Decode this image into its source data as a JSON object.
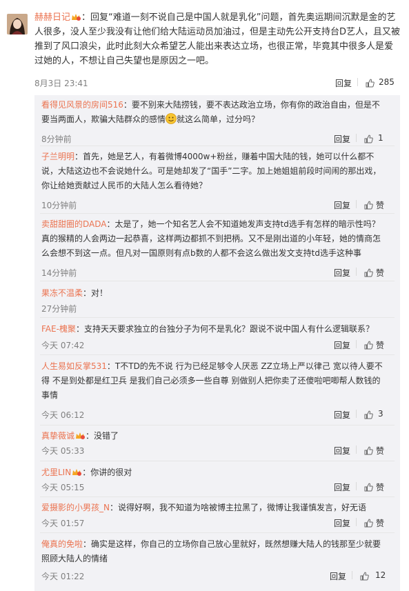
{
  "main_comment": {
    "username": "赫赫日记",
    "text": "：回复“难道一刻不说自己是中国人就是乳化”问题，首先奥运期间沉默是金的艺人很多，没人至少我没有让他们给大陆运动员加油过，但是主动先公开支持台D艺人，且又被推到了风口浪尖，此时此刻大众希望艺人能出来表达立场，也很正常，毕竟其中很多人是爱过她的人，不想让自己失望也是原因之一吧。",
    "time": "8月3日 23:41",
    "reply_label": "回复",
    "likes": "285"
  },
  "replies": [
    {
      "username": "看得见风景的房间516",
      "text_parts": [
        "：要不别来大陆捞钱，要不表达政治立场，你有你的政治自由，但是不要当两面人，欺骗大陆群众的感情",
        "就这么简单，过分吗？"
      ],
      "time": "8分钟前",
      "reply_label": "回复",
      "likes": "1"
    },
    {
      "username": "子兰明明",
      "text": "：首先，她是艺人，有着微博4000w+粉丝，赚着中国大陆的钱，她可以什么都不说，大陆这边也不会说她什么。可是她却发了“国手”二字。加上她姐姐前段时间闹的那出戏，你让给她贡献过人民币的大陆人怎么看待她？",
      "time": "10分钟前",
      "reply_label": "回复",
      "likes": "赞"
    },
    {
      "username": "卖甜甜圈的DADA",
      "text": "：太是了，她一个知名艺人会不知道她发声支持td选手有怎样的暗示性吗？真的猴精的人会两边一起恭喜，这样两边都抓不到把柄。又不是刚出道的小年轻，她的情商怎么会想不到这一点。但凡对一国原则有点b数的人都不会这么做出发文支持td选手这种事",
      "time": "14分钟前",
      "reply_label": "回复",
      "likes": "赞"
    },
    {
      "username": "果冻不温柔",
      "text": "：对！",
      "time": "27分钟前",
      "reply_label": "回复",
      "likes": "赞"
    },
    {
      "username": "FAE-槐聚",
      "text": "：支持天天要求独立的台独分子为何不是乳化？跟说不说中国人有什么逻辑联系？",
      "time": "今天 07:42",
      "reply_label": "回复",
      "likes": "赞"
    },
    {
      "username": "人生易如反掌531",
      "text": "：T不TD的先不说 行为已经足够令人厌恶 ZZ立场上严以律己 宽以待人要不得 不是到处都是红卫兵 是我们自己必须多一些自尊 别做别人把你卖了还傻啦吧唧帮人数钱的事情",
      "time": "今天 06:12",
      "reply_label": "回复",
      "likes": "3"
    },
    {
      "username": "真挚薇诚",
      "text": "：没错了",
      "time": "今天 05:33",
      "reply_label": "回复",
      "likes": "赞"
    },
    {
      "username": "尤里LIN",
      "text": "：你讲的很对",
      "time": "今天 05:15",
      "reply_label": "回复",
      "likes": "赞"
    },
    {
      "username": "爱摄影的小男孩_N",
      "text": "：说得好啊，我不知道为啥被博主拉黑了，微博让我谨慎发言，好无语",
      "time": "今天 01:57",
      "reply_label": "回复",
      "likes": "赞"
    },
    {
      "username": "俺真的免啦",
      "text": "：确实是这样，你自己的立场你自己放心里就好，既然想赚大陆人的钱那至少就要照顾大陆人的情绪",
      "time": "今天 01:22",
      "reply_label": "回复",
      "likes": "12"
    }
  ],
  "colors": {
    "username": "#eb7350",
    "reply_bg": "#f2f2f5",
    "meta": "#808080"
  },
  "icons": {
    "like": "thumbs-up-icon",
    "badge": "vip-crown-icon",
    "emoji": "smile-emoji-icon"
  }
}
